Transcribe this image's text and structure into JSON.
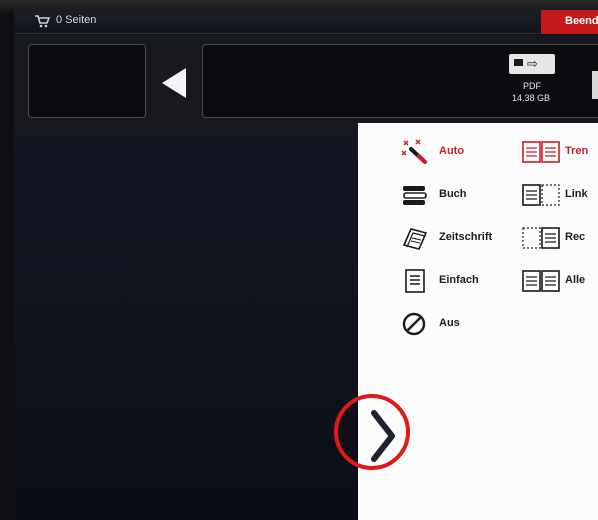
{
  "topbar": {
    "cart_icon": "cart-icon",
    "pages_label": "0 Seiten",
    "finish_label": "Beend"
  },
  "storage": {
    "icon": "usb-card-icon",
    "type": "PDF",
    "size": "14.38 GB"
  },
  "options_left": [
    {
      "label": "Auto",
      "icon": "magic-wand-icon",
      "active": true
    },
    {
      "label": "Buch",
      "icon": "book-stack-icon",
      "active": false
    },
    {
      "label": "Zeitschrift",
      "icon": "magazine-icon",
      "active": false
    },
    {
      "label": "Einfach",
      "icon": "single-page-icon",
      "active": false
    },
    {
      "label": "Aus",
      "icon": "off-icon",
      "active": false
    }
  ],
  "options_right": [
    {
      "label": "Tren",
      "icon": "two-pages-icon",
      "active": true
    },
    {
      "label": "Link",
      "icon": "left-page-icon",
      "active": false
    },
    {
      "label": "Rec",
      "icon": "right-page-icon",
      "active": false
    },
    {
      "label": "Alle",
      "icon": "all-pages-icon",
      "active": false
    }
  ],
  "colors": {
    "accent_red": "#c8202a",
    "annotation_red": "#e21818",
    "panel_bg": "#fcfcfc",
    "screen_bg": "#0d0f1a"
  },
  "collapse_icon": "chevron-right-icon"
}
